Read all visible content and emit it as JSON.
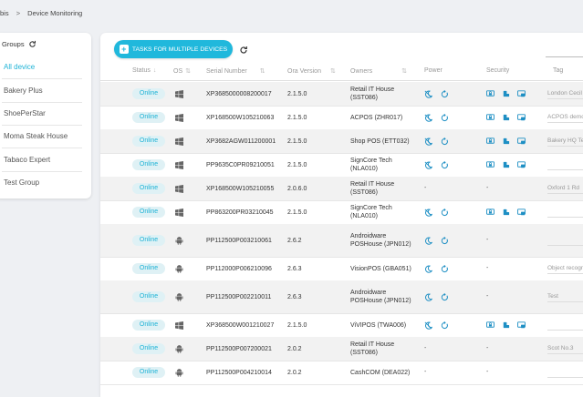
{
  "breadcrumb": {
    "parent": "bis",
    "separator": ">",
    "current": "Device Monitoring"
  },
  "groups": {
    "title": "Groups",
    "items": [
      "All device",
      "Bakery Plus",
      "ShoePerStar",
      "Moma Steak House",
      "Tabaco Expert",
      "Test Group"
    ]
  },
  "toolbar": {
    "task_button_label": "TASKS FOR MULTIPLE DEVICES"
  },
  "table": {
    "headers": {
      "status": "Status",
      "os": "OS",
      "serial": "Serial Number",
      "ora": "Ora Version",
      "owners": "Owners",
      "power": "Power",
      "security": "Security",
      "tag": "Tag"
    },
    "rows": [
      {
        "status": "Online",
        "os": "windows",
        "serial": "XP3685000008200017",
        "ora": "2.1.5.0",
        "owner1": "Retail IT House",
        "owner2": "(SST086)",
        "power": true,
        "security": true,
        "tag": "London Cecil"
      },
      {
        "status": "Online",
        "os": "windows",
        "serial": "XP168500W105210063",
        "ora": "2.1.5.0",
        "owner1": "ACPOS (ZHR017)",
        "owner2": "",
        "power": true,
        "security": true,
        "tag": "ACPOS demo"
      },
      {
        "status": "Online",
        "os": "windows",
        "serial": "XP3682AGW011200001",
        "ora": "2.1.5.0",
        "owner1": "Shop POS (ETT032)",
        "owner2": "",
        "power": true,
        "security": true,
        "tag": "Bakery HQ Te"
      },
      {
        "status": "Online",
        "os": "windows",
        "serial": "PP9635C0PR09210051",
        "ora": "2.1.5.0",
        "owner1": "SignCore Tech",
        "owner2": "(NLA010)",
        "power": true,
        "security": true,
        "tag": ""
      },
      {
        "status": "Online",
        "os": "windows",
        "serial": "XP168500W105210055",
        "ora": "2.0.6.0",
        "owner1": "Retail IT House",
        "owner2": "(SST086)",
        "power": false,
        "security": false,
        "tag": "Oxford 1 Rd"
      },
      {
        "status": "Online",
        "os": "windows",
        "serial": "PP863200PR03210045",
        "ora": "2.1.5.0",
        "owner1": "SignCore Tech",
        "owner2": "(NLA010)",
        "power": true,
        "security": true,
        "tag": ""
      },
      {
        "status": "Online",
        "os": "android",
        "serial": "PP112500P003210061",
        "ora": "2.6.2",
        "owner1": "Androidware",
        "owner2": "POSHouse (JPN012)",
        "power": true,
        "security": false,
        "tag": ""
      },
      {
        "status": "Online",
        "os": "android",
        "serial": "PP112000P006210096",
        "ora": "2.6.3",
        "owner1": "VisionPOS (GBA051)",
        "owner2": "",
        "power": true,
        "security": false,
        "tag": "Object recogn"
      },
      {
        "status": "Online",
        "os": "android",
        "serial": "PP112500P002210011",
        "ora": "2.6.3",
        "owner1": "Androidware",
        "owner2": "POSHouse (JPN012)",
        "power": true,
        "security": false,
        "tag": "Test"
      },
      {
        "status": "Online",
        "os": "windows",
        "serial": "XP368500W001210027",
        "ora": "2.1.5.0",
        "owner1": "ViVIPOS (TWA006)",
        "owner2": "",
        "power": true,
        "security": true,
        "tag": ""
      },
      {
        "status": "Online",
        "os": "android",
        "serial": "PP112500P007200021",
        "ora": "2.0.2",
        "owner1": "Retail IT House",
        "owner2": "(SST086)",
        "power": false,
        "security": false,
        "tag": "Scot No.3"
      },
      {
        "status": "Online",
        "os": "android",
        "serial": "PP112500P004210014",
        "ora": "2.0.2",
        "owner1": "CashCOM (DEA022)",
        "owner2": "",
        "power": false,
        "security": false,
        "tag": ""
      }
    ]
  },
  "empty_value": "-",
  "colors": {
    "accent": "#20b8dc",
    "badge_bg": "#dff1f5",
    "row_shade": "#f2f2f2"
  },
  "icons": {
    "windows": "windows-icon",
    "android": "android-icon",
    "power_sleep": "moon-icon",
    "power_restart": "restart-icon",
    "security": [
      "lock-screen-icon",
      "usb-lock-icon",
      "app-lock-icon"
    ],
    "refresh": "refresh-icon"
  }
}
